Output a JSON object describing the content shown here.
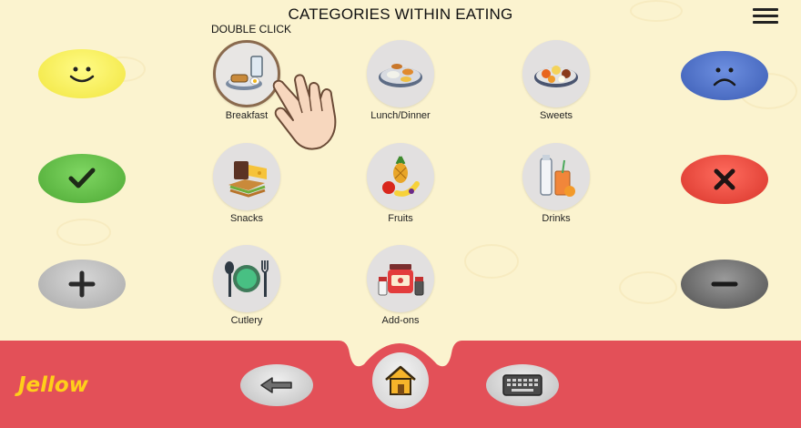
{
  "header": {
    "title": "CATEGORIES WITHIN EATING",
    "menu_icon": "hamburger-menu-icon"
  },
  "hint": {
    "text": "DOUBLE CLICK"
  },
  "expressive_buttons": {
    "like": {
      "icon": "smiley-face-icon",
      "color": "#f3e84a"
    },
    "dislike": {
      "icon": "sad-face-icon",
      "color": "#4a6fc4"
    },
    "yes": {
      "icon": "checkmark-icon",
      "color": "#5fba46"
    },
    "no": {
      "icon": "cross-icon",
      "color": "#e8443a"
    },
    "more": {
      "icon": "plus-icon",
      "color": "#bdbdbd"
    },
    "less": {
      "icon": "minus-icon",
      "color": "#767676"
    }
  },
  "categories": [
    {
      "label": "Breakfast",
      "icon": "breakfast-icon",
      "selected": true
    },
    {
      "label": "Lunch/Dinner",
      "icon": "lunch-dinner-icon"
    },
    {
      "label": "Sweets",
      "icon": "sweets-icon"
    },
    {
      "label": "Snacks",
      "icon": "snacks-icon"
    },
    {
      "label": "Fruits",
      "icon": "fruits-icon"
    },
    {
      "label": "Drinks",
      "icon": "drinks-icon"
    },
    {
      "label": "Cutlery",
      "icon": "cutlery-icon"
    },
    {
      "label": "Add-ons",
      "icon": "add-ons-icon"
    }
  ],
  "bottom_bar": {
    "color": "#e35058",
    "logo_text": "Jellow",
    "back_icon": "back-arrow-icon",
    "home_icon": "home-icon",
    "keyboard_icon": "keyboard-icon"
  }
}
